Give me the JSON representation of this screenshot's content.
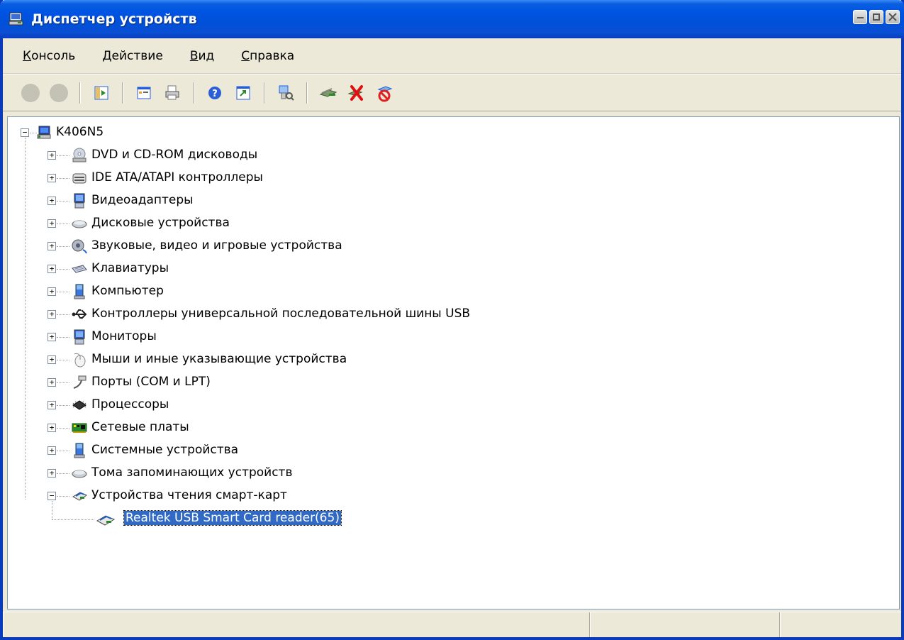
{
  "window": {
    "title": "Диспетчер устройств"
  },
  "menu": [
    {
      "label_rest": "онсоль",
      "accel": "К"
    },
    {
      "label_rest": "ействие",
      "accel": "Д"
    },
    {
      "label_rest": "ид",
      "accel": "В"
    },
    {
      "label_rest": "правка",
      "accel": "С"
    }
  ],
  "toolbar": {
    "buttons": [
      "back-icon",
      "forward-icon",
      "show-hide-tree-icon",
      "properties-icon",
      "print-icon",
      "help-icon",
      "export-icon",
      "scan-hardware-icon",
      "update-driver-icon",
      "uninstall-icon",
      "disable-icon"
    ]
  },
  "tree": {
    "root": "K406N5",
    "categories": [
      "DVD и CD-ROM дисководы",
      "IDE ATA/ATAPI контроллеры",
      "Видеоадаптеры",
      "Дисковые устройства",
      "Звуковые, видео и игровые устройства",
      "Клавиатуры",
      "Компьютер",
      "Контроллеры универсальной последовательной шины USB",
      "Мониторы",
      "Мыши и иные указывающие устройства",
      "Порты (COM и LPT)",
      "Процессоры",
      "Сетевые платы",
      "Системные устройства",
      "Тома запоминающих устройств",
      "Устройства чтения смарт-карт"
    ],
    "selected_device": "Realtek USB Smart Card reader(65)"
  }
}
